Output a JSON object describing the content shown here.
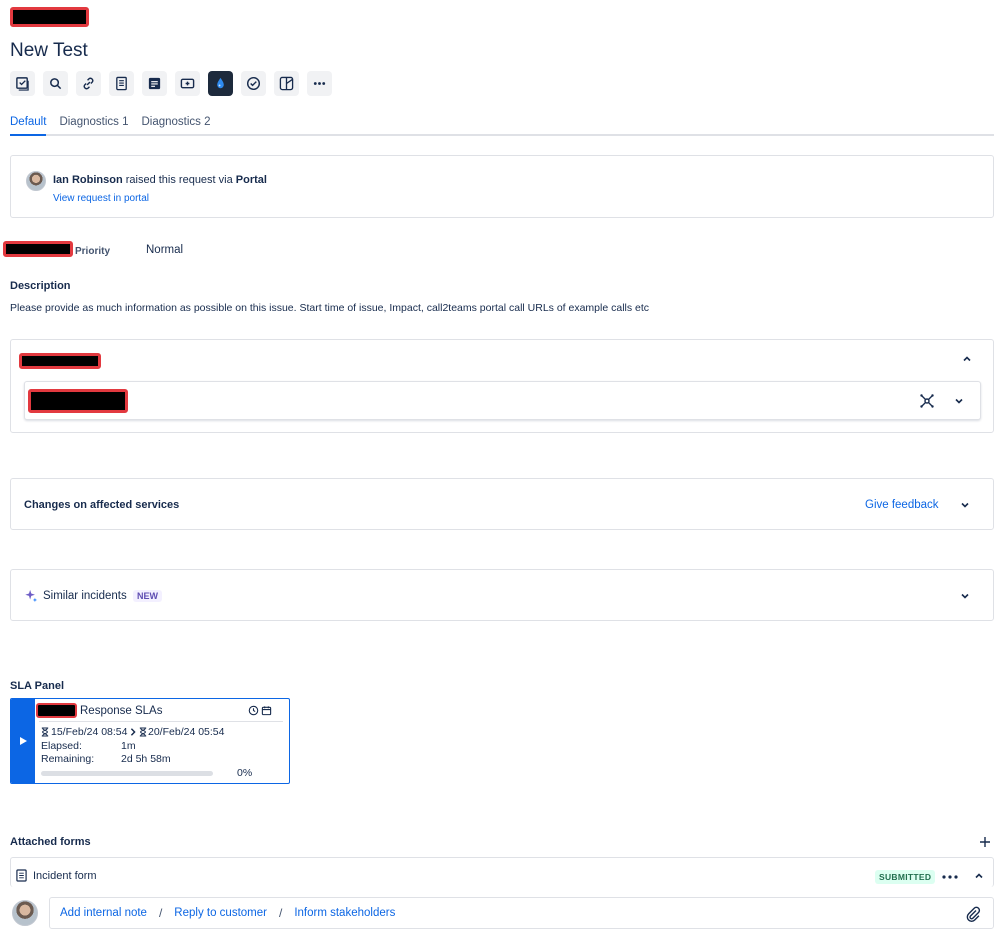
{
  "issue": {
    "title": "New Test"
  },
  "toolbar": {
    "buttons": [
      "checklist-icon",
      "search-icon",
      "link-icon",
      "document-icon",
      "notes-icon",
      "add-screen-icon",
      "drop-icon",
      "check-circle-icon",
      "split-icon",
      "more-icon"
    ]
  },
  "tabs": [
    {
      "label": "Default",
      "active": true
    },
    {
      "label": "Diagnostics 1",
      "active": false
    },
    {
      "label": "Diagnostics 2",
      "active": false
    }
  ],
  "request": {
    "reporter": "Ian Robinson",
    "raised_text": " raised this request via ",
    "channel": "Portal",
    "view_link": "View request in portal"
  },
  "fields": {
    "priority_label": "Priority",
    "priority_value": "Normal"
  },
  "description": {
    "heading": "Description",
    "text": "Please provide as much information as possible on this issue. Start time of issue, Impact, call2teams portal call URLs of example calls etc"
  },
  "changes_section": {
    "title": "Changes on affected services",
    "feedback_link": "Give feedback"
  },
  "similar_section": {
    "title": "Similar incidents",
    "badge": "NEW"
  },
  "sla": {
    "heading": "SLA Panel",
    "name": "Response SLAs",
    "start": "15/Feb/24 08:54",
    "end": "20/Feb/24 05:54",
    "elapsed_label": "Elapsed:",
    "elapsed_value": "1m",
    "remaining_label": "Remaining:",
    "remaining_value": "2d 5h 58m",
    "progress_text": "0%",
    "progress": 0
  },
  "forms": {
    "heading": "Attached forms",
    "items": [
      {
        "name": "Incident form",
        "status": "SUBMITTED"
      }
    ]
  },
  "comment": {
    "add_internal_note": "Add internal note",
    "reply_to_customer": "Reply to customer",
    "inform_stakeholders": "Inform stakeholders",
    "separator": "/"
  },
  "colors": {
    "accent": "#0c66e4",
    "text": "#172b4d",
    "redaction_border": "#e2393f"
  }
}
